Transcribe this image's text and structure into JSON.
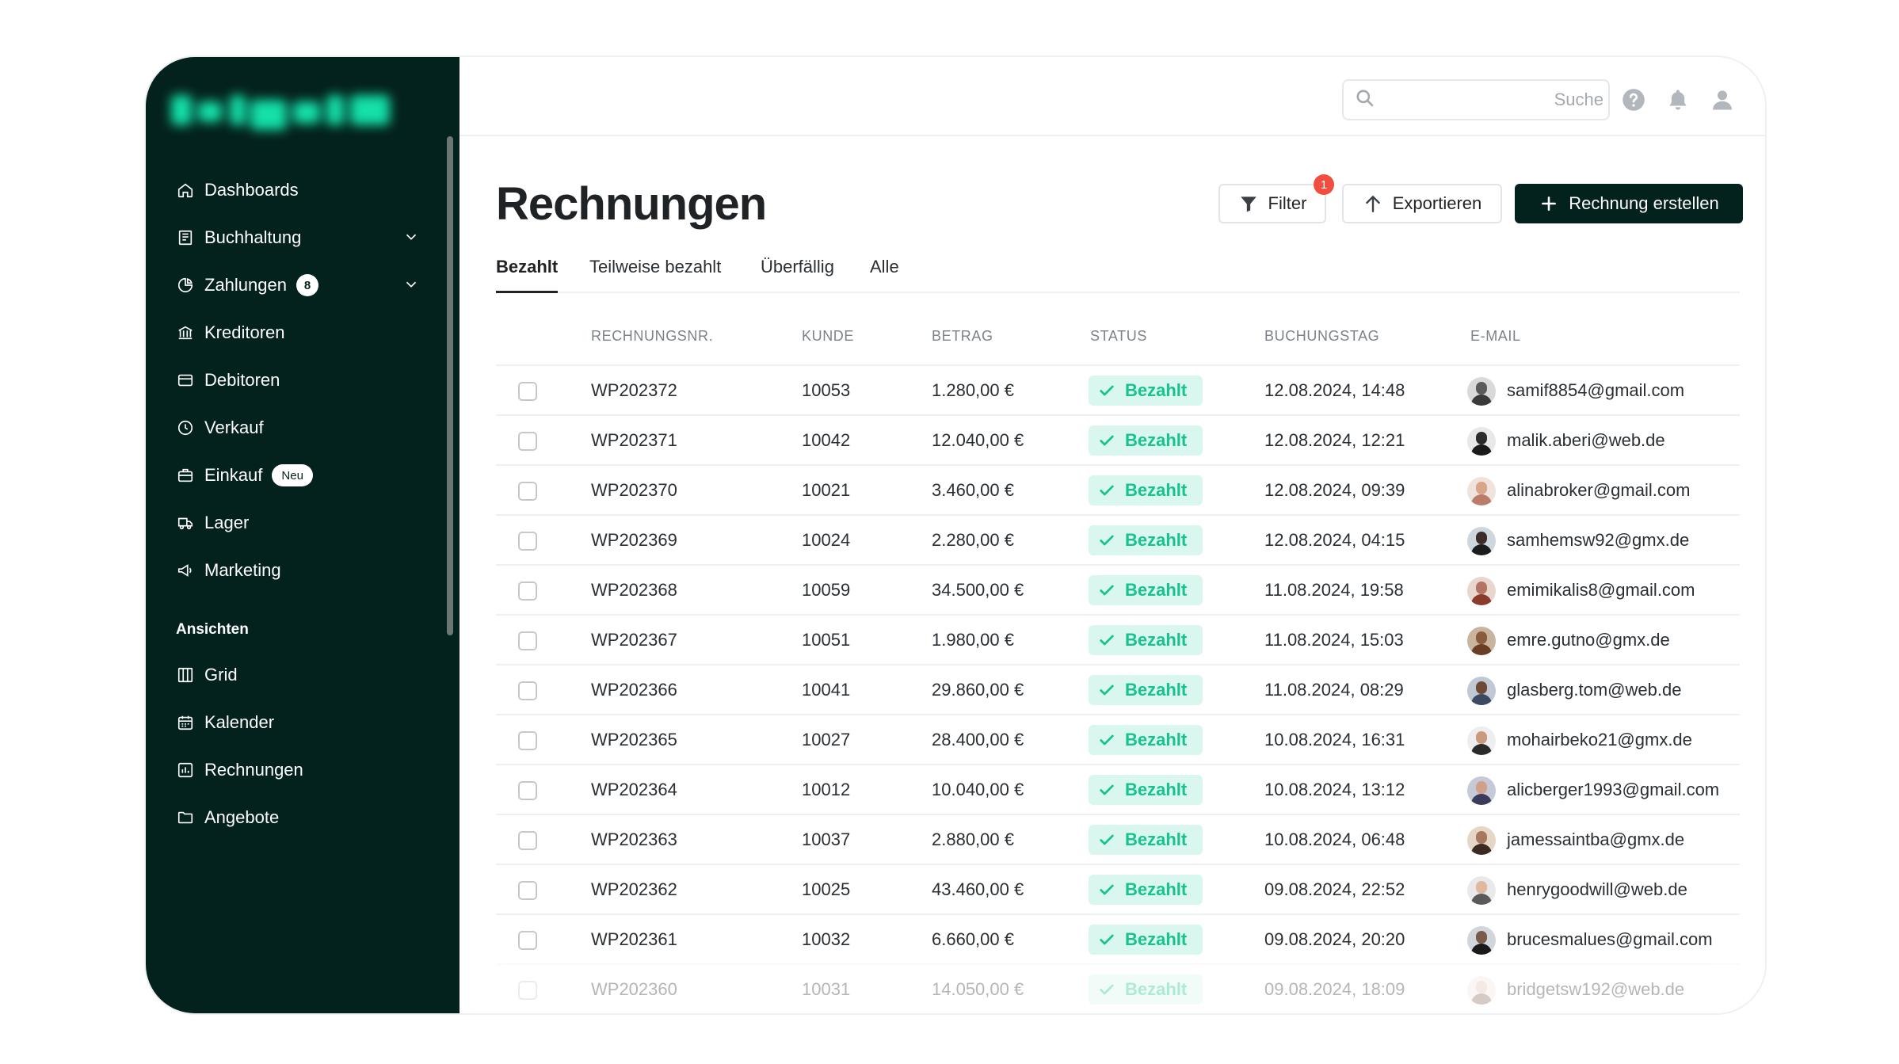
{
  "sidebar": {
    "nav": [
      {
        "label": "Dashboards",
        "icon": "home-icon"
      },
      {
        "label": "Buchhaltung",
        "icon": "ledger-icon",
        "expandable": true
      },
      {
        "label": "Zahlungen",
        "icon": "pie-chart-icon",
        "badge": "8",
        "expandable": true
      },
      {
        "label": "Kreditoren",
        "icon": "bank-icon"
      },
      {
        "label": "Debitoren",
        "icon": "credit-card-icon"
      },
      {
        "label": "Verkauf",
        "icon": "clock-icon"
      },
      {
        "label": "Einkauf",
        "icon": "briefcase-icon",
        "tag": "Neu"
      },
      {
        "label": "Lager",
        "icon": "truck-icon"
      },
      {
        "label": "Marketing",
        "icon": "megaphone-icon"
      }
    ],
    "section_label": "Ansichten",
    "views": [
      {
        "label": "Grid",
        "icon": "grid-icon"
      },
      {
        "label": "Kalender",
        "icon": "calendar-icon"
      },
      {
        "label": "Rechnungen",
        "icon": "bar-chart-icon"
      },
      {
        "label": "Angebote",
        "icon": "folder-icon"
      }
    ]
  },
  "topbar": {
    "search_placeholder": "Suche",
    "icons": [
      "search-icon",
      "help-icon",
      "bell-icon",
      "user-icon"
    ]
  },
  "page": {
    "title": "Rechnungen",
    "filter_label": "Filter",
    "filter_count": "1",
    "export_label": "Exportieren",
    "create_label": "Rechnung erstellen"
  },
  "tabs": [
    {
      "label": "Bezahlt",
      "active": true
    },
    {
      "label": "Teilweise bezahlt",
      "active": false
    },
    {
      "label": "Überfällig",
      "active": false
    },
    {
      "label": "Alle",
      "active": false
    }
  ],
  "table": {
    "columns": [
      "RECHNUNGSNR.",
      "KUNDE",
      "BETRAG",
      "STATUS",
      "BUCHUNGSTAG",
      "E-MAIL"
    ],
    "rows": [
      {
        "nr": "WP202372",
        "kunde": "10053",
        "betrag": "1.280,00 €",
        "status": "Bezahlt",
        "tag": "12.08.2024, 14:48",
        "email": "samif8854@gmail.com"
      },
      {
        "nr": "WP202371",
        "kunde": "10042",
        "betrag": "12.040,00 €",
        "status": "Bezahlt",
        "tag": "12.08.2024, 12:21",
        "email": "malik.aberi@web.de"
      },
      {
        "nr": "WP202370",
        "kunde": "10021",
        "betrag": "3.460,00 €",
        "status": "Bezahlt",
        "tag": "12.08.2024, 09:39",
        "email": "alinabroker@gmail.com"
      },
      {
        "nr": "WP202369",
        "kunde": "10024",
        "betrag": "2.280,00 €",
        "status": "Bezahlt",
        "tag": "12.08.2024, 04:15",
        "email": "samhemsw92@gmx.de"
      },
      {
        "nr": "WP202368",
        "kunde": "10059",
        "betrag": "34.500,00 €",
        "status": "Bezahlt",
        "tag": "11.08.2024, 19:58",
        "email": "emimikalis8@gmail.com"
      },
      {
        "nr": "WP202367",
        "kunde": "10051",
        "betrag": "1.980,00 €",
        "status": "Bezahlt",
        "tag": "11.08.2024, 15:03",
        "email": "emre.gutno@gmx.de"
      },
      {
        "nr": "WP202366",
        "kunde": "10041",
        "betrag": "29.860,00 €",
        "status": "Bezahlt",
        "tag": "11.08.2024, 08:29",
        "email": "glasberg.tom@web.de"
      },
      {
        "nr": "WP202365",
        "kunde": "10027",
        "betrag": "28.400,00 €",
        "status": "Bezahlt",
        "tag": "10.08.2024, 16:31",
        "email": "mohairbeko21@gmx.de"
      },
      {
        "nr": "WP202364",
        "kunde": "10012",
        "betrag": "10.040,00 €",
        "status": "Bezahlt",
        "tag": "10.08.2024, 13:12",
        "email": "alicberger1993@gmail.com"
      },
      {
        "nr": "WP202363",
        "kunde": "10037",
        "betrag": "2.880,00 €",
        "status": "Bezahlt",
        "tag": "10.08.2024, 06:48",
        "email": "jamessaintba@gmx.de"
      },
      {
        "nr": "WP202362",
        "kunde": "10025",
        "betrag": "43.460,00 €",
        "status": "Bezahlt",
        "tag": "09.08.2024, 22:52",
        "email": "henrygoodwill@web.de"
      },
      {
        "nr": "WP202361",
        "kunde": "10032",
        "betrag": "6.660,00 €",
        "status": "Bezahlt",
        "tag": "09.08.2024, 20:20",
        "email": "brucesmalues@gmail.com"
      },
      {
        "nr": "WP202360",
        "kunde": "10031",
        "betrag": "14.050,00 €",
        "status": "Bezahlt",
        "tag": "09.08.2024, 18:09",
        "email": "bridgetsw192@web.de"
      }
    ]
  },
  "colors": {
    "sidebar_bg": "#04221d",
    "primary": "#04221d",
    "status_text": "#18c28f",
    "status_bg": "#d9f7ef",
    "filter_badge": "#f04e3e"
  }
}
